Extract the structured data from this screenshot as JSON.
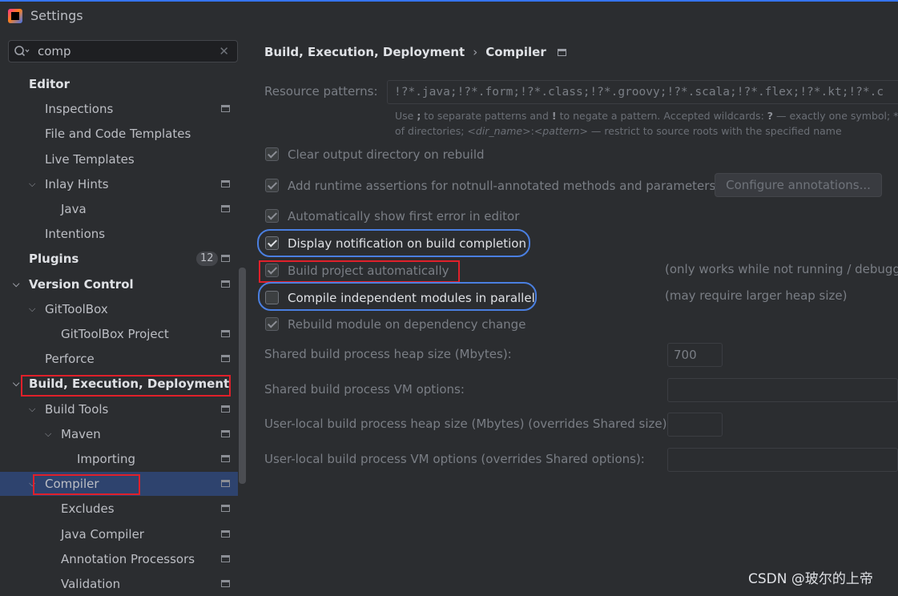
{
  "window": {
    "title": "Settings"
  },
  "search": {
    "value": "comp"
  },
  "tree": [
    {
      "label": "Editor",
      "level": 0,
      "bold": true,
      "chevron": "",
      "icon": false
    },
    {
      "label": "Inspections",
      "level": 1,
      "bold": false,
      "chevron": "",
      "icon": true
    },
    {
      "label": "File and Code Templates",
      "level": 1,
      "bold": false,
      "chevron": "",
      "icon": false
    },
    {
      "label": "Live Templates",
      "level": 1,
      "bold": false,
      "chevron": "",
      "icon": false
    },
    {
      "label": "Inlay Hints",
      "level": 1,
      "bold": false,
      "chevron": "down",
      "icon": true
    },
    {
      "label": "Java",
      "level": 2,
      "bold": false,
      "chevron": "",
      "icon": true
    },
    {
      "label": "Intentions",
      "level": 1,
      "bold": false,
      "chevron": "",
      "icon": false
    },
    {
      "label": "Plugins",
      "level": 0,
      "bold": true,
      "chevron": "",
      "icon": true,
      "badge": "12"
    },
    {
      "label": "Version Control",
      "level": 0,
      "bold": true,
      "chevron": "down",
      "icon": true
    },
    {
      "label": "GitToolBox",
      "level": 1,
      "bold": false,
      "chevron": "down",
      "icon": false
    },
    {
      "label": "GitToolBox Project",
      "level": 2,
      "bold": false,
      "chevron": "",
      "icon": true
    },
    {
      "label": "Perforce",
      "level": 1,
      "bold": false,
      "chevron": "",
      "icon": true
    },
    {
      "label": "Build, Execution, Deployment",
      "level": 0,
      "bold": true,
      "chevron": "down",
      "icon": false
    },
    {
      "label": "Build Tools",
      "level": 1,
      "bold": false,
      "chevron": "down",
      "icon": true
    },
    {
      "label": "Maven",
      "level": 2,
      "bold": false,
      "chevron": "down",
      "icon": true
    },
    {
      "label": "Importing",
      "level": 3,
      "bold": false,
      "chevron": "",
      "icon": true
    },
    {
      "label": "Compiler",
      "level": 1,
      "bold": false,
      "chevron": "down",
      "icon": true,
      "selected": true
    },
    {
      "label": "Excludes",
      "level": 2,
      "bold": false,
      "chevron": "",
      "icon": true
    },
    {
      "label": "Java Compiler",
      "level": 2,
      "bold": false,
      "chevron": "",
      "icon": true
    },
    {
      "label": "Annotation Processors",
      "level": 2,
      "bold": false,
      "chevron": "",
      "icon": true
    },
    {
      "label": "Validation",
      "level": 2,
      "bold": false,
      "chevron": "",
      "icon": true
    }
  ],
  "breadcrumb": {
    "parent": "Build, Execution, Deployment",
    "current": "Compiler"
  },
  "resource": {
    "label": "Resource patterns:",
    "value": "!?*.java;!?*.form;!?*.class;!?*.groovy;!?*.scala;!?*.flex;!?*.kt;!?*.c",
    "hint1_a": "Use ",
    "hint1_b": ";",
    "hint1_c": " to separate patterns and ",
    "hint1_d": "!",
    "hint1_e": " to negate a pattern. Accepted wildcards: ",
    "hint1_f": "?",
    "hint1_g": " — exactly one symbol; * —",
    "hint2_a": "of directories; ",
    "hint2_b": "<dir_name>",
    "hint2_c": ":",
    "hint2_d": "<pattern>",
    "hint2_e": " — restrict to source roots with the specified name"
  },
  "options": {
    "clear_output": "Clear output directory on rebuild",
    "runtime_assertions": "Add runtime assertions for notnull-annotated methods and parameters",
    "configure_annotations": "Configure annotations...",
    "show_first_error": "Automatically show first error in editor",
    "display_notification": "Display notification on build completion",
    "build_automatically": "Build project automatically",
    "build_automatically_note": "(only works while not running / debuggi",
    "compile_parallel": "Compile independent modules in parallel",
    "compile_parallel_note": "(may require larger heap size)",
    "rebuild_dependency": "Rebuild module on dependency change"
  },
  "fields": {
    "shared_heap_label": "Shared build process heap size (Mbytes):",
    "shared_heap_value": "700",
    "shared_vm_label": "Shared build process VM options:",
    "user_heap_label": "User-local build process heap size (Mbytes) (overrides Shared size):",
    "user_vm_label": "User-local build process VM options (overrides Shared options):"
  },
  "watermark": "CSDN @玻尔的上帝",
  "colors": {
    "accent": "#3574f0",
    "selection": "#2e436e",
    "highlight_red": "#e0202a",
    "highlight_blue": "#4a7fe0"
  }
}
